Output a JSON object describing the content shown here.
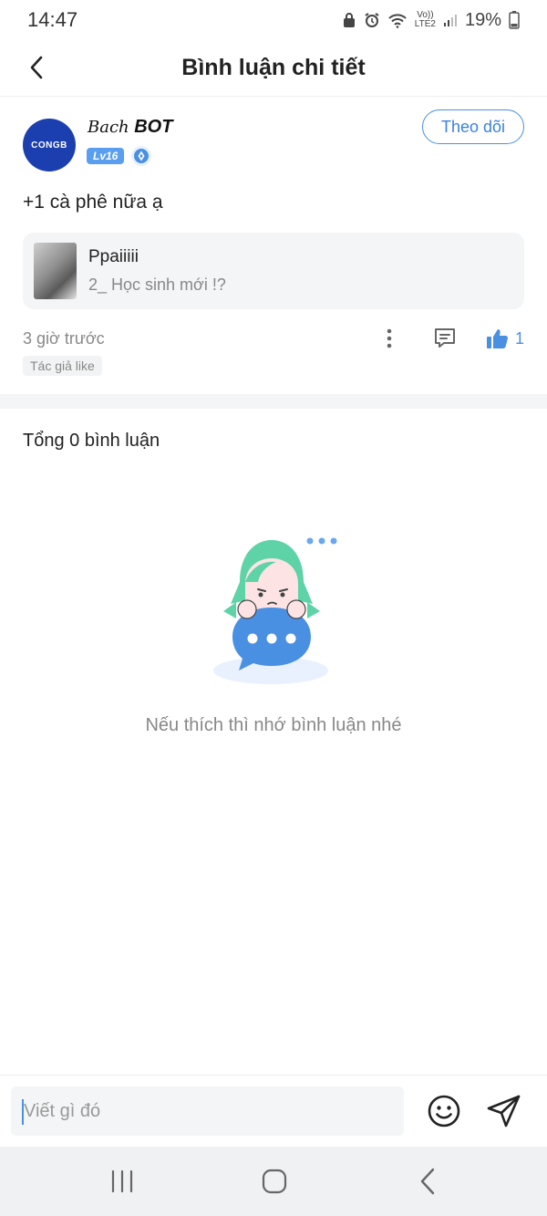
{
  "status_bar": {
    "time": "14:47",
    "battery": "19%",
    "network_top": "Vo))",
    "network_bottom": "LTE2"
  },
  "header": {
    "title": "Bình luận chi tiết"
  },
  "post": {
    "author_script": "Bach",
    "author_name": "BOT",
    "avatar_text": "CONGB",
    "level": "Lv16",
    "follow_label": "Theo dõi",
    "comment": "+1 cà phê nữa ạ",
    "quote": {
      "user": "Ppaiiiii",
      "post_title": "2_ Học sinh mới !?"
    },
    "time": "3 giờ trước",
    "like_count": "1",
    "author_like_tag": "Tác giả like"
  },
  "comments": {
    "total_label": "Tổng 0 bình luận",
    "empty_text": "Nếu thích thì nhớ bình luận nhé"
  },
  "input": {
    "placeholder": "Viết gì đó"
  },
  "colors": {
    "accent": "#4a90e2",
    "avatar_bg": "#1c3fb0",
    "muted_text": "#888888",
    "panel_bg": "#f4f5f7"
  }
}
